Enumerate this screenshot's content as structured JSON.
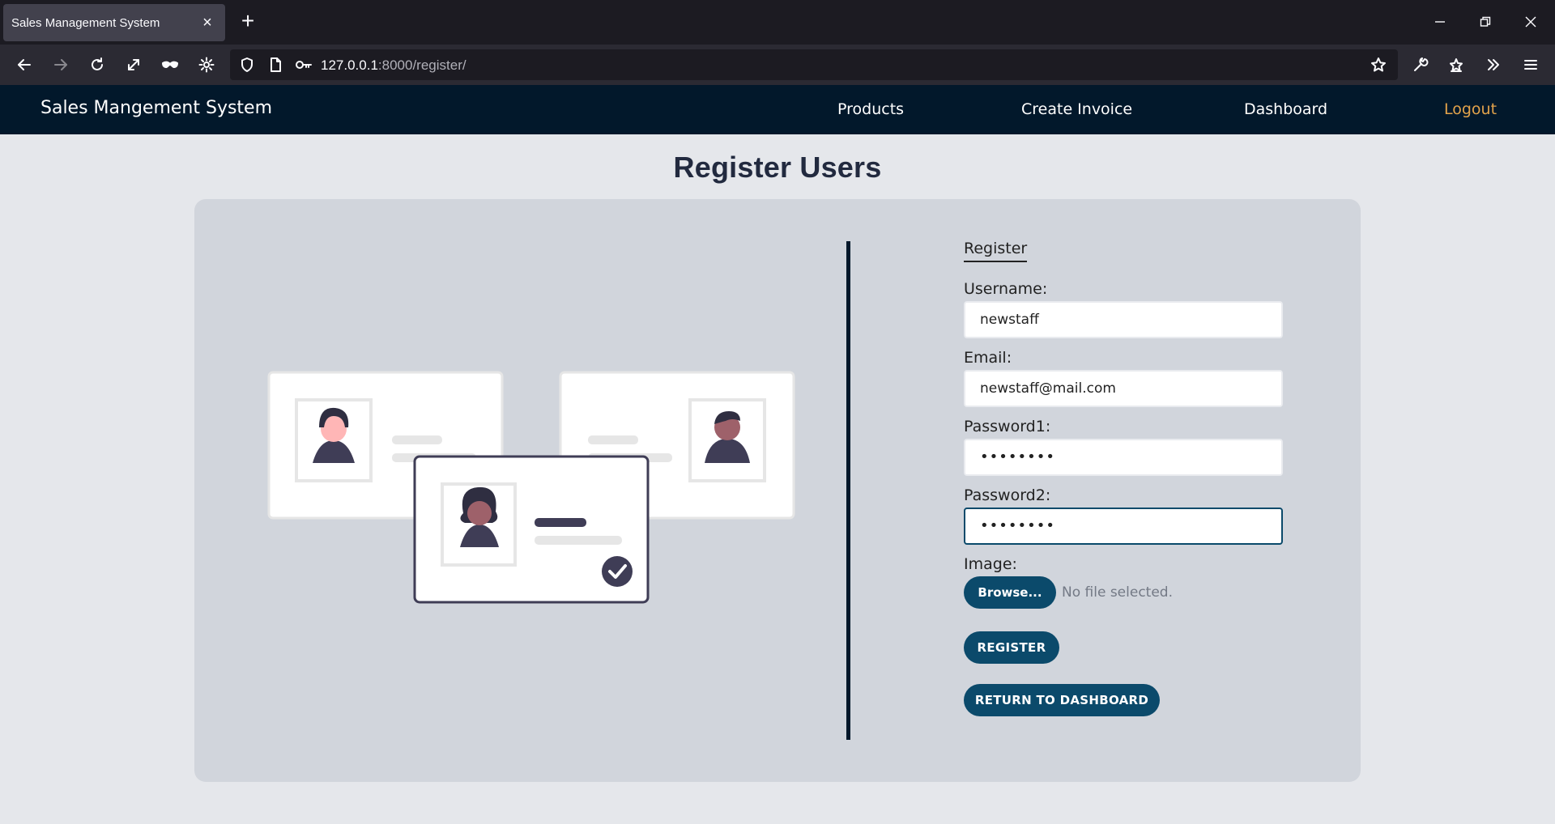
{
  "browser": {
    "tab_title": "Sales Management System",
    "tab_close": "×",
    "new_tab": "+",
    "url_host": "127.0.0.1",
    "url_rest": ":8000/register/"
  },
  "app": {
    "brand": "Sales Mangement System",
    "nav": {
      "products": "Products",
      "create_invoice": "Create Invoice",
      "dashboard": "Dashboard",
      "logout": "Logout"
    },
    "colors": {
      "nav_bg": "#02182b",
      "logout": "#e3a34b",
      "button": "#0b4a6b"
    }
  },
  "page": {
    "title": "Register Users"
  },
  "form": {
    "legend": "Register",
    "username_label": "Username:",
    "username_value": "newstaff",
    "email_label": "Email:",
    "email_value": "newstaff@mail.com",
    "password1_label": "Password1:",
    "password1_value": "••••••••",
    "password2_label": "Password2:",
    "password2_value": "••••••••",
    "image_label": "Image:",
    "browse_label": "Browse...",
    "no_file_text": "No file selected.",
    "register_label": "REGISTER",
    "return_label": "RETURN TO DASHBOARD"
  }
}
